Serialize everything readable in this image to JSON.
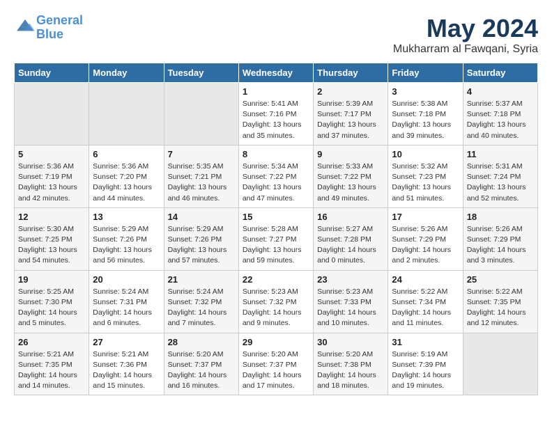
{
  "header": {
    "logo_line1": "General",
    "logo_line2": "Blue",
    "month": "May 2024",
    "location": "Mukharram al Fawqani, Syria"
  },
  "weekdays": [
    "Sunday",
    "Monday",
    "Tuesday",
    "Wednesday",
    "Thursday",
    "Friday",
    "Saturday"
  ],
  "weeks": [
    [
      {
        "day": "",
        "info": ""
      },
      {
        "day": "",
        "info": ""
      },
      {
        "day": "",
        "info": ""
      },
      {
        "day": "1",
        "info": "Sunrise: 5:41 AM\nSunset: 7:16 PM\nDaylight: 13 hours\nand 35 minutes."
      },
      {
        "day": "2",
        "info": "Sunrise: 5:39 AM\nSunset: 7:17 PM\nDaylight: 13 hours\nand 37 minutes."
      },
      {
        "day": "3",
        "info": "Sunrise: 5:38 AM\nSunset: 7:18 PM\nDaylight: 13 hours\nand 39 minutes."
      },
      {
        "day": "4",
        "info": "Sunrise: 5:37 AM\nSunset: 7:18 PM\nDaylight: 13 hours\nand 40 minutes."
      }
    ],
    [
      {
        "day": "5",
        "info": "Sunrise: 5:36 AM\nSunset: 7:19 PM\nDaylight: 13 hours\nand 42 minutes."
      },
      {
        "day": "6",
        "info": "Sunrise: 5:36 AM\nSunset: 7:20 PM\nDaylight: 13 hours\nand 44 minutes."
      },
      {
        "day": "7",
        "info": "Sunrise: 5:35 AM\nSunset: 7:21 PM\nDaylight: 13 hours\nand 46 minutes."
      },
      {
        "day": "8",
        "info": "Sunrise: 5:34 AM\nSunset: 7:22 PM\nDaylight: 13 hours\nand 47 minutes."
      },
      {
        "day": "9",
        "info": "Sunrise: 5:33 AM\nSunset: 7:22 PM\nDaylight: 13 hours\nand 49 minutes."
      },
      {
        "day": "10",
        "info": "Sunrise: 5:32 AM\nSunset: 7:23 PM\nDaylight: 13 hours\nand 51 minutes."
      },
      {
        "day": "11",
        "info": "Sunrise: 5:31 AM\nSunset: 7:24 PM\nDaylight: 13 hours\nand 52 minutes."
      }
    ],
    [
      {
        "day": "12",
        "info": "Sunrise: 5:30 AM\nSunset: 7:25 PM\nDaylight: 13 hours\nand 54 minutes."
      },
      {
        "day": "13",
        "info": "Sunrise: 5:29 AM\nSunset: 7:26 PM\nDaylight: 13 hours\nand 56 minutes."
      },
      {
        "day": "14",
        "info": "Sunrise: 5:29 AM\nSunset: 7:26 PM\nDaylight: 13 hours\nand 57 minutes."
      },
      {
        "day": "15",
        "info": "Sunrise: 5:28 AM\nSunset: 7:27 PM\nDaylight: 13 hours\nand 59 minutes."
      },
      {
        "day": "16",
        "info": "Sunrise: 5:27 AM\nSunset: 7:28 PM\nDaylight: 14 hours\nand 0 minutes."
      },
      {
        "day": "17",
        "info": "Sunrise: 5:26 AM\nSunset: 7:29 PM\nDaylight: 14 hours\nand 2 minutes."
      },
      {
        "day": "18",
        "info": "Sunrise: 5:26 AM\nSunset: 7:29 PM\nDaylight: 14 hours\nand 3 minutes."
      }
    ],
    [
      {
        "day": "19",
        "info": "Sunrise: 5:25 AM\nSunset: 7:30 PM\nDaylight: 14 hours\nand 5 minutes."
      },
      {
        "day": "20",
        "info": "Sunrise: 5:24 AM\nSunset: 7:31 PM\nDaylight: 14 hours\nand 6 minutes."
      },
      {
        "day": "21",
        "info": "Sunrise: 5:24 AM\nSunset: 7:32 PM\nDaylight: 14 hours\nand 7 minutes."
      },
      {
        "day": "22",
        "info": "Sunrise: 5:23 AM\nSunset: 7:32 PM\nDaylight: 14 hours\nand 9 minutes."
      },
      {
        "day": "23",
        "info": "Sunrise: 5:23 AM\nSunset: 7:33 PM\nDaylight: 14 hours\nand 10 minutes."
      },
      {
        "day": "24",
        "info": "Sunrise: 5:22 AM\nSunset: 7:34 PM\nDaylight: 14 hours\nand 11 minutes."
      },
      {
        "day": "25",
        "info": "Sunrise: 5:22 AM\nSunset: 7:35 PM\nDaylight: 14 hours\nand 12 minutes."
      }
    ],
    [
      {
        "day": "26",
        "info": "Sunrise: 5:21 AM\nSunset: 7:35 PM\nDaylight: 14 hours\nand 14 minutes."
      },
      {
        "day": "27",
        "info": "Sunrise: 5:21 AM\nSunset: 7:36 PM\nDaylight: 14 hours\nand 15 minutes."
      },
      {
        "day": "28",
        "info": "Sunrise: 5:20 AM\nSunset: 7:37 PM\nDaylight: 14 hours\nand 16 minutes."
      },
      {
        "day": "29",
        "info": "Sunrise: 5:20 AM\nSunset: 7:37 PM\nDaylight: 14 hours\nand 17 minutes."
      },
      {
        "day": "30",
        "info": "Sunrise: 5:20 AM\nSunset: 7:38 PM\nDaylight: 14 hours\nand 18 minutes."
      },
      {
        "day": "31",
        "info": "Sunrise: 5:19 AM\nSunset: 7:39 PM\nDaylight: 14 hours\nand 19 minutes."
      },
      {
        "day": "",
        "info": ""
      }
    ]
  ]
}
